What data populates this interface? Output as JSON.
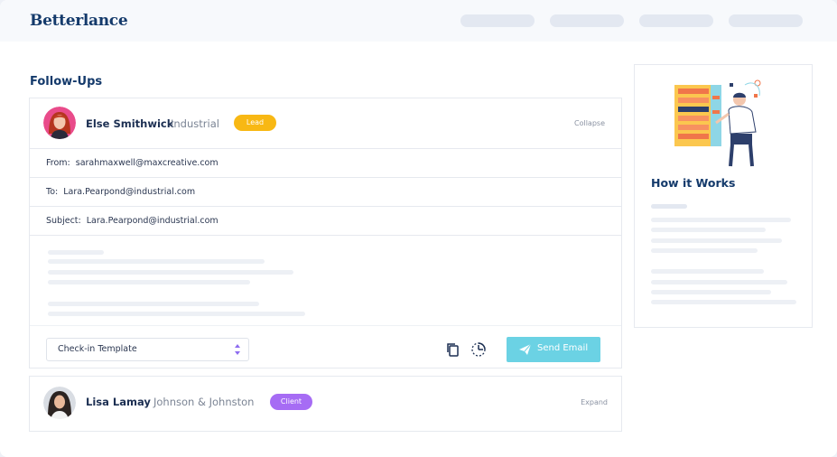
{
  "brand": {
    "name": "Betterlance"
  },
  "nav": {
    "item_count": 4
  },
  "followups": {
    "title": "Follow-Ups",
    "expanded": {
      "name": "Else Smithwick",
      "company": "Industrial",
      "badge": "Lead",
      "badge_color": "#f8b814",
      "toggle": "Collapse",
      "from_label": "From:",
      "from_value": "sarahmaxwell@maxcreative.com",
      "to_label": "To:",
      "to_value": "Lara.Pearpond@industrial.com",
      "subject_label": "Subject:",
      "subject_value": "Lara.Pearpond@industrial.com",
      "template_select": "Check-in Template",
      "send_label": "Send Email",
      "send_color": "#6bd2e4"
    },
    "collapsed": {
      "name": "Lisa Lamay",
      "company": "Johnson & Johnston",
      "badge": "Client",
      "badge_color": "#a66cf4",
      "toggle": "Expand"
    }
  },
  "side_panel": {
    "title": "How it Works"
  },
  "icons": [
    "copy-icon",
    "schedule-icon",
    "send-icon",
    "select-arrows-icon"
  ]
}
